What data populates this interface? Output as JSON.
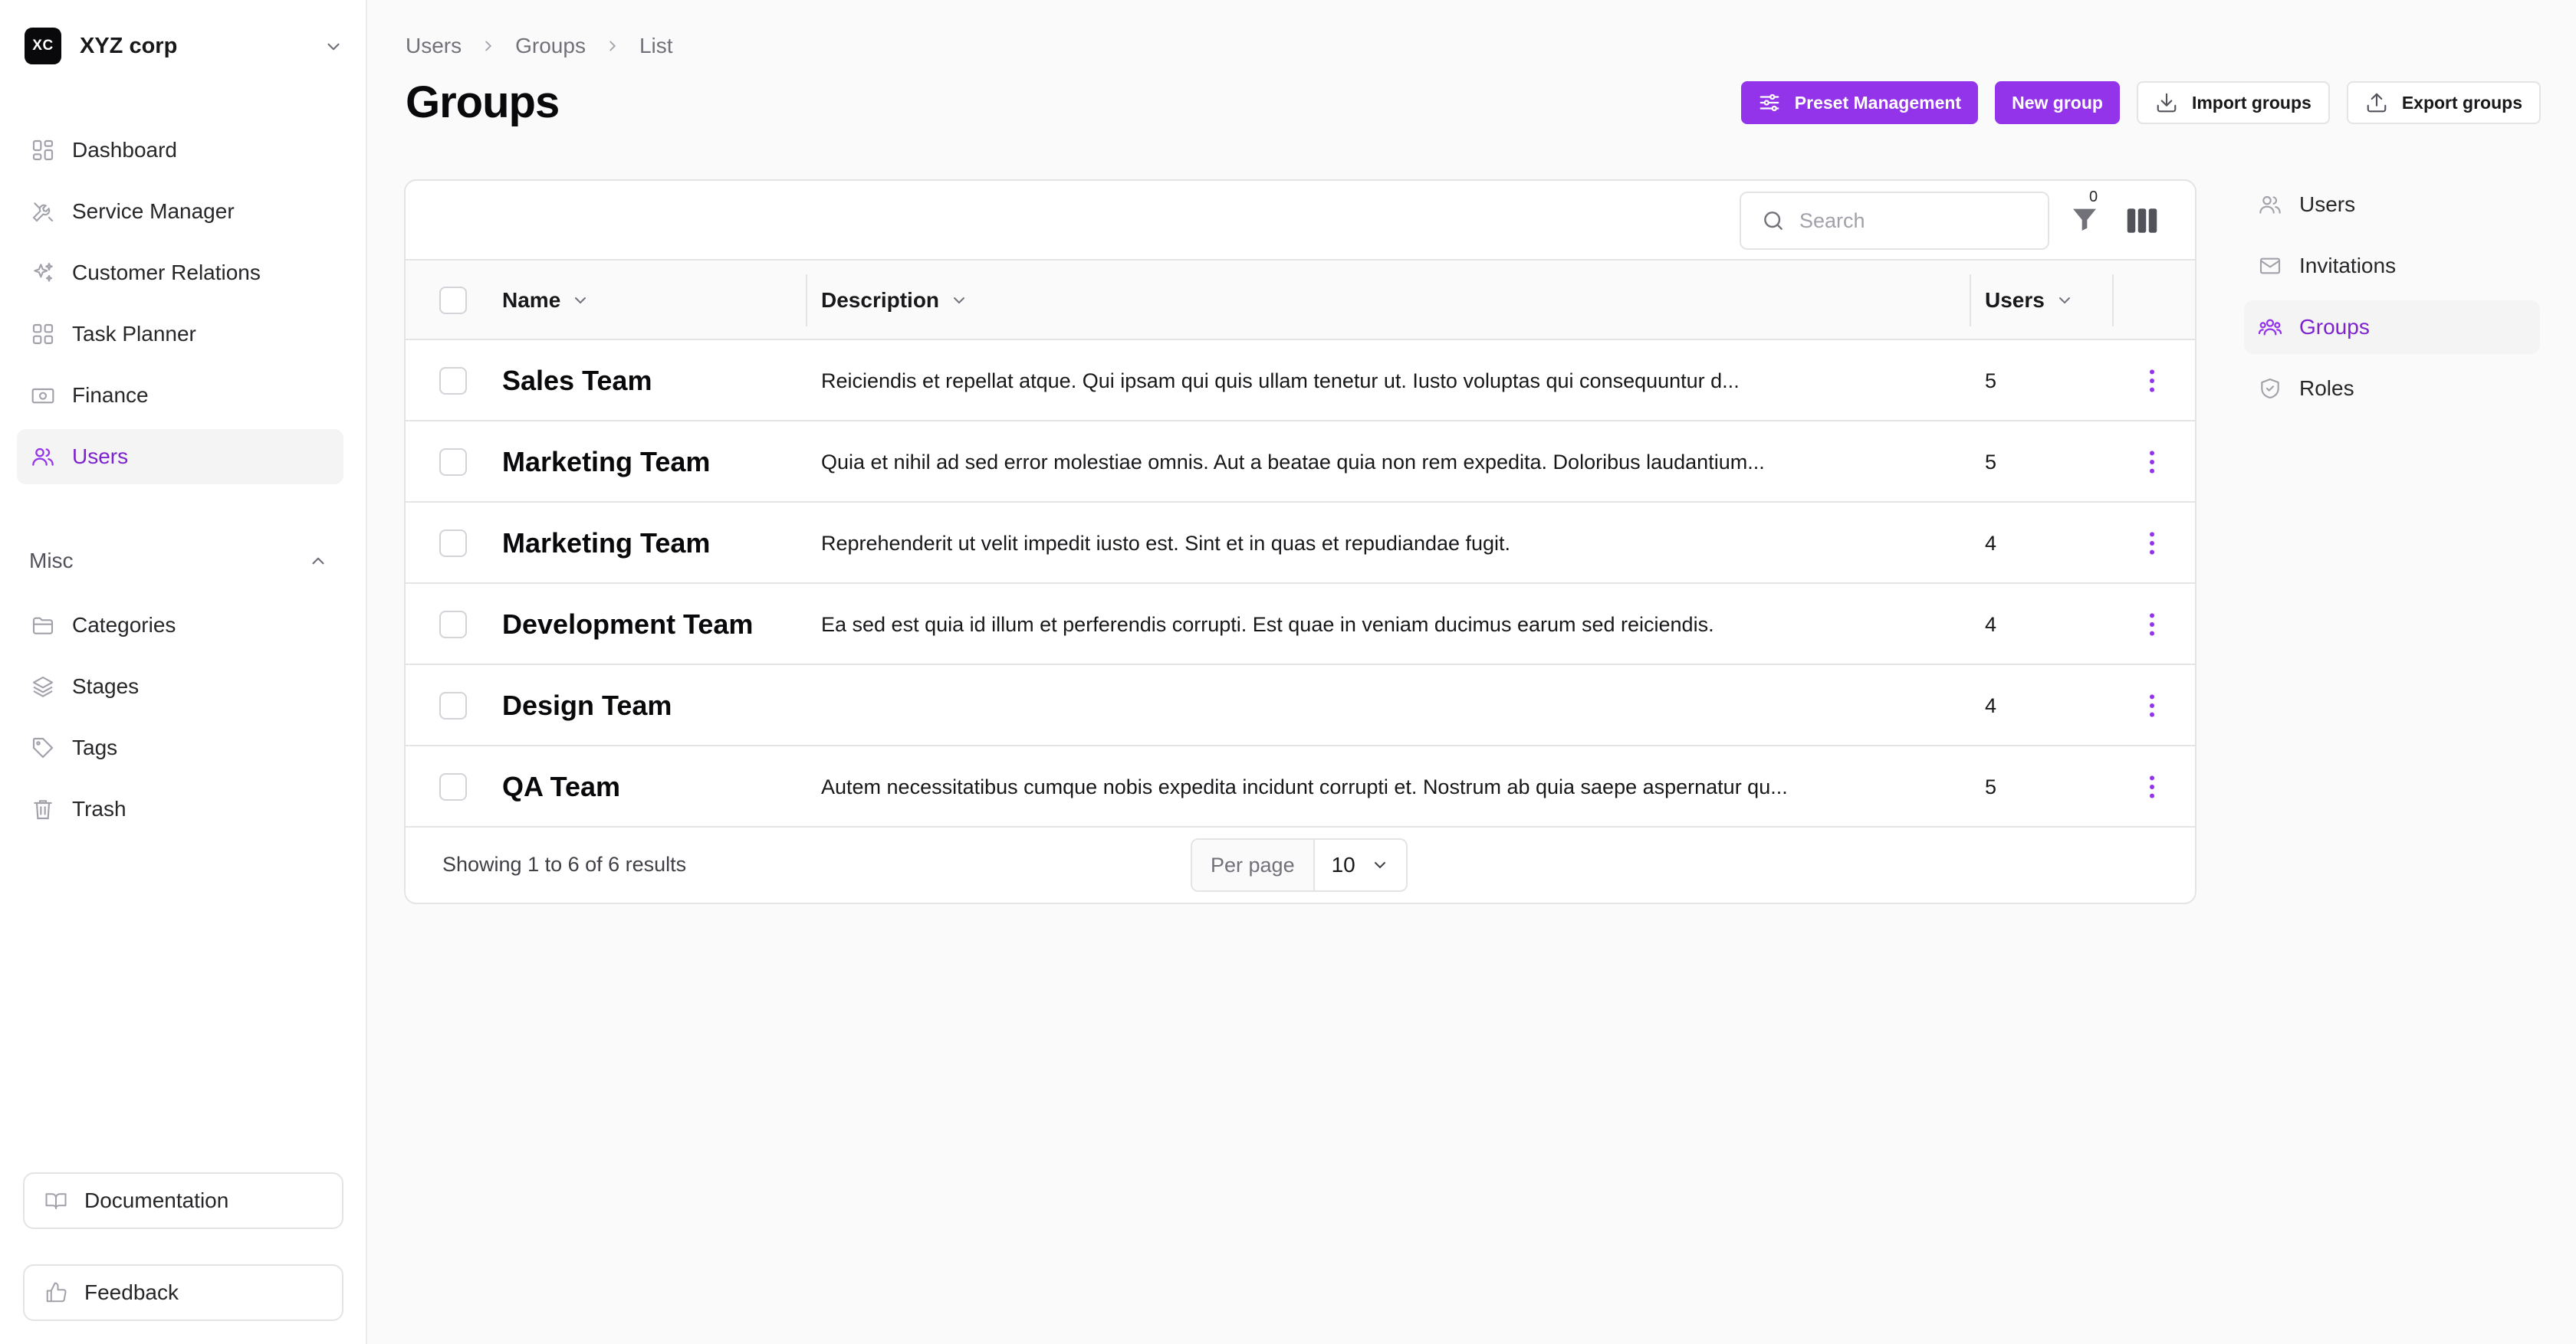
{
  "brand": {
    "logo_text": "XC",
    "name": "XYZ corp"
  },
  "sidebar": {
    "items": [
      {
        "label": "Dashboard",
        "icon": "dashboard-icon"
      },
      {
        "label": "Service Manager",
        "icon": "tools-icon"
      },
      {
        "label": "Customer Relations",
        "icon": "sparkles-icon"
      },
      {
        "label": "Task Planner",
        "icon": "grid-icon"
      },
      {
        "label": "Finance",
        "icon": "banknote-icon"
      },
      {
        "label": "Users",
        "icon": "users-icon",
        "active": true
      }
    ],
    "misc_title": "Misc",
    "misc_items": [
      {
        "label": "Categories",
        "icon": "folder-icon"
      },
      {
        "label": "Stages",
        "icon": "layers-icon"
      },
      {
        "label": "Tags",
        "icon": "tag-icon"
      },
      {
        "label": "Trash",
        "icon": "trash-icon"
      }
    ],
    "documentation": "Documentation",
    "feedback": "Feedback"
  },
  "breadcrumb": [
    "Users",
    "Groups",
    "List"
  ],
  "page": {
    "title": "Groups"
  },
  "actions": {
    "preset": "Preset Management",
    "new_group": "New group",
    "import": "Import groups",
    "export": "Export groups"
  },
  "toolbar": {
    "search_placeholder": "Search",
    "filter_count": "0"
  },
  "table": {
    "columns": [
      "Name",
      "Description",
      "Users"
    ],
    "rows": [
      {
        "name": "Sales Team",
        "description": "Reiciendis et repellat atque. Qui ipsam qui quis ullam tenetur ut. Iusto voluptas qui consequuntur d...",
        "users": "5"
      },
      {
        "name": "Marketing Team",
        "description": "Quia et nihil ad sed error molestiae omnis. Aut a beatae quia non rem expedita. Doloribus laudantium...",
        "users": "5"
      },
      {
        "name": "Marketing Team",
        "description": "Reprehenderit ut velit impedit iusto est. Sint et in quas et repudiandae fugit.",
        "users": "4"
      },
      {
        "name": "Development Team",
        "description": "Ea sed est quia id illum et perferendis corrupti. Est quae in veniam ducimus earum sed reiciendis.",
        "users": "4"
      },
      {
        "name": "Design Team",
        "description": "",
        "users": "4"
      },
      {
        "name": "QA Team",
        "description": "Autem necessitatibus cumque nobis expedita incidunt corrupti et. Nostrum ab quia saepe aspernatur qu...",
        "users": "5"
      }
    ],
    "showing": "Showing 1 to 6 of 6 results",
    "per_page_label": "Per page",
    "per_page_value": "10"
  },
  "subnav": {
    "items": [
      {
        "label": "Users",
        "icon": "users-icon"
      },
      {
        "label": "Invitations",
        "icon": "envelope-icon"
      },
      {
        "label": "Groups",
        "icon": "user-group-icon",
        "active": true
      },
      {
        "label": "Roles",
        "icon": "shield-icon"
      }
    ]
  },
  "colors": {
    "accent": "#9333ea",
    "accent_text": "#7e22ce",
    "active_bg": "#f4f4f5"
  }
}
